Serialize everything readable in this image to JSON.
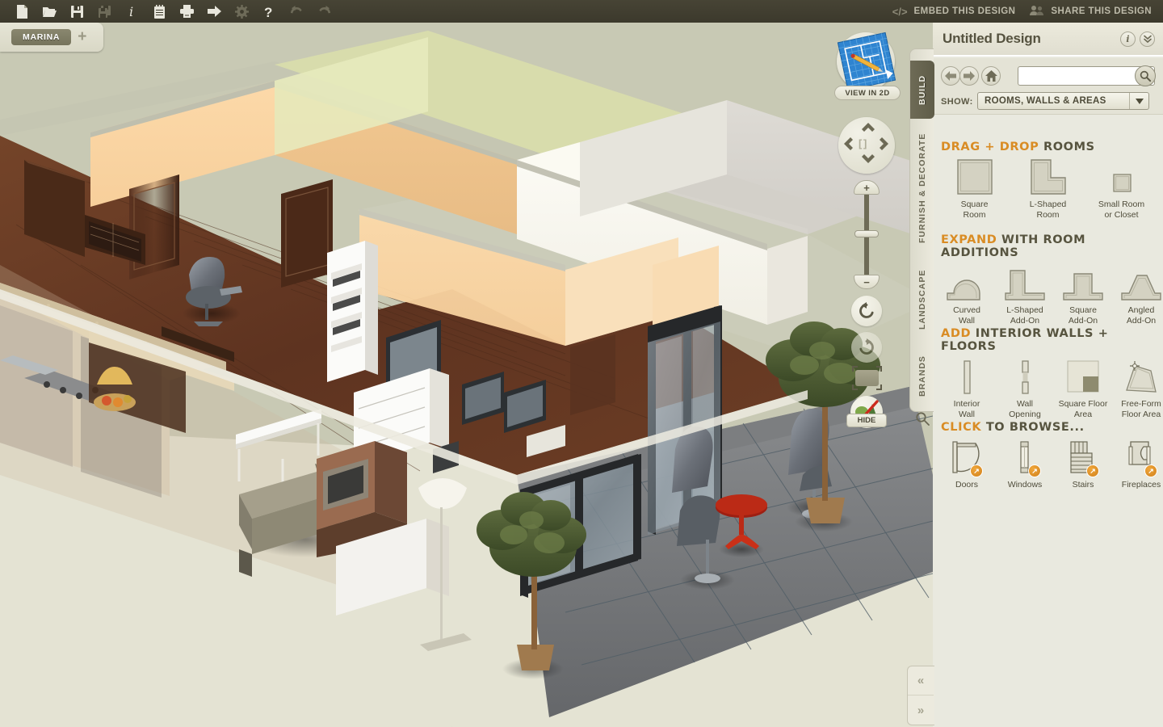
{
  "toolbar": {
    "icons": [
      {
        "name": "new-document-icon",
        "label": "New"
      },
      {
        "name": "open-folder-icon",
        "label": "Open"
      },
      {
        "name": "save-icon",
        "label": "Save"
      },
      {
        "name": "save-as-icon",
        "label": "Save As"
      },
      {
        "name": "info-icon",
        "label": "Info"
      },
      {
        "name": "notes-icon",
        "label": "Notes"
      },
      {
        "name": "print-icon",
        "label": "Print"
      },
      {
        "name": "export-icon",
        "label": "Export"
      },
      {
        "name": "settings-gear-icon",
        "label": "Settings"
      },
      {
        "name": "help-icon",
        "label": "Help"
      },
      {
        "name": "undo-icon",
        "label": "Undo"
      },
      {
        "name": "redo-icon",
        "label": "Redo"
      }
    ],
    "embed_label": "EMBED THIS DESIGN",
    "share_label": "SHARE THIS DESIGN",
    "embed_glyph": "</>",
    "background_color": "#3f3c2e"
  },
  "tabbar": {
    "project_tab": "MARINA",
    "add_tab": "+"
  },
  "viewport": {
    "view_in_2d_label": "VIEW IN 2D",
    "hide_label": "HIDE",
    "dpad": {
      "up": "▲",
      "down": "▼",
      "left": "◀",
      "right": "▶",
      "center": "[ ]"
    },
    "zoom": {
      "plus": "+",
      "minus": "−"
    },
    "sky_color": "#c8c9b4",
    "ground_color": "#e4e3d3",
    "floor_wood_color": "#6b3f28",
    "patio_color": "#76787a"
  },
  "vertical_tabs": [
    {
      "label": "BUILD",
      "active": true
    },
    {
      "label": "FURNISH & DECORATE",
      "active": false
    },
    {
      "label": "LANDSCAPE",
      "active": false
    },
    {
      "label": "BRANDS",
      "active": false
    }
  ],
  "panel": {
    "title": "Untitled Design",
    "header_buttons": [
      {
        "name": "info-icon",
        "glyph": "i"
      },
      {
        "name": "collapse-chevrons-icon",
        "glyph": "»"
      }
    ],
    "nav": {
      "back": "←",
      "forward": "→",
      "home": "⌂"
    },
    "search": {
      "value": "",
      "placeholder": ""
    },
    "show": {
      "label": "SHOW:",
      "value": "ROOMS, WALLS & AREAS",
      "arrow": "▼",
      "options": [
        "ROOMS, WALLS & AREAS"
      ]
    },
    "sections": [
      {
        "id": "rooms",
        "head_accent": "DRAG + DROP",
        "head_rest": "ROOMS",
        "items": [
          {
            "name": "square-room",
            "caption": "Square\nRoom",
            "icon": "square-room-icon"
          },
          {
            "name": "l-shaped-room",
            "caption": "L-Shaped\nRoom",
            "icon": "l-shaped-room-icon"
          },
          {
            "name": "small-room-or-closet",
            "caption": "Small Room\nor Closet",
            "icon": "small-room-icon"
          }
        ]
      },
      {
        "id": "expand",
        "head_accent": "EXPAND",
        "head_rest": "WITH ROOM ADDITIONS",
        "items": [
          {
            "name": "curved-wall",
            "caption": "Curved\nWall",
            "icon": "curved-wall-icon"
          },
          {
            "name": "l-shaped-add-on",
            "caption": "L-Shaped\nAdd-On",
            "icon": "l-shaped-addon-icon"
          },
          {
            "name": "square-add-on",
            "caption": "Square\nAdd-On",
            "icon": "square-addon-icon"
          },
          {
            "name": "angled-add-on",
            "caption": "Angled\nAdd-On",
            "icon": "angled-addon-icon"
          }
        ]
      },
      {
        "id": "walls",
        "head_accent": "ADD",
        "head_rest": "INTERIOR WALLS + FLOORS",
        "items": [
          {
            "name": "interior-wall",
            "caption": "Interior\nWall",
            "icon": "interior-wall-icon"
          },
          {
            "name": "wall-opening",
            "caption": "Wall\nOpening",
            "icon": "wall-opening-icon"
          },
          {
            "name": "square-floor-area",
            "caption": "Square Floor\nArea",
            "icon": "square-floor-icon"
          },
          {
            "name": "free-form-floor-area",
            "caption": "Free-Form\nFloor Area",
            "icon": "free-form-floor-icon"
          }
        ]
      },
      {
        "id": "browse",
        "head_accent": "CLICK",
        "head_rest": "TO BROWSE...",
        "items": [
          {
            "name": "doors",
            "caption": "Doors",
            "icon": "door-icon",
            "badge": "↗"
          },
          {
            "name": "windows",
            "caption": "Windows",
            "icon": "window-icon",
            "badge": "↗"
          },
          {
            "name": "stairs",
            "caption": "Stairs",
            "icon": "stairs-icon",
            "badge": "↗"
          },
          {
            "name": "fireplaces",
            "caption": "Fireplaces",
            "icon": "fireplace-icon",
            "badge": "↗"
          }
        ]
      }
    ],
    "accent_color": "#d98c24",
    "background_color": "#e9e9df"
  },
  "collapse": {
    "left_arrow": "«",
    "right_arrow": "»"
  }
}
